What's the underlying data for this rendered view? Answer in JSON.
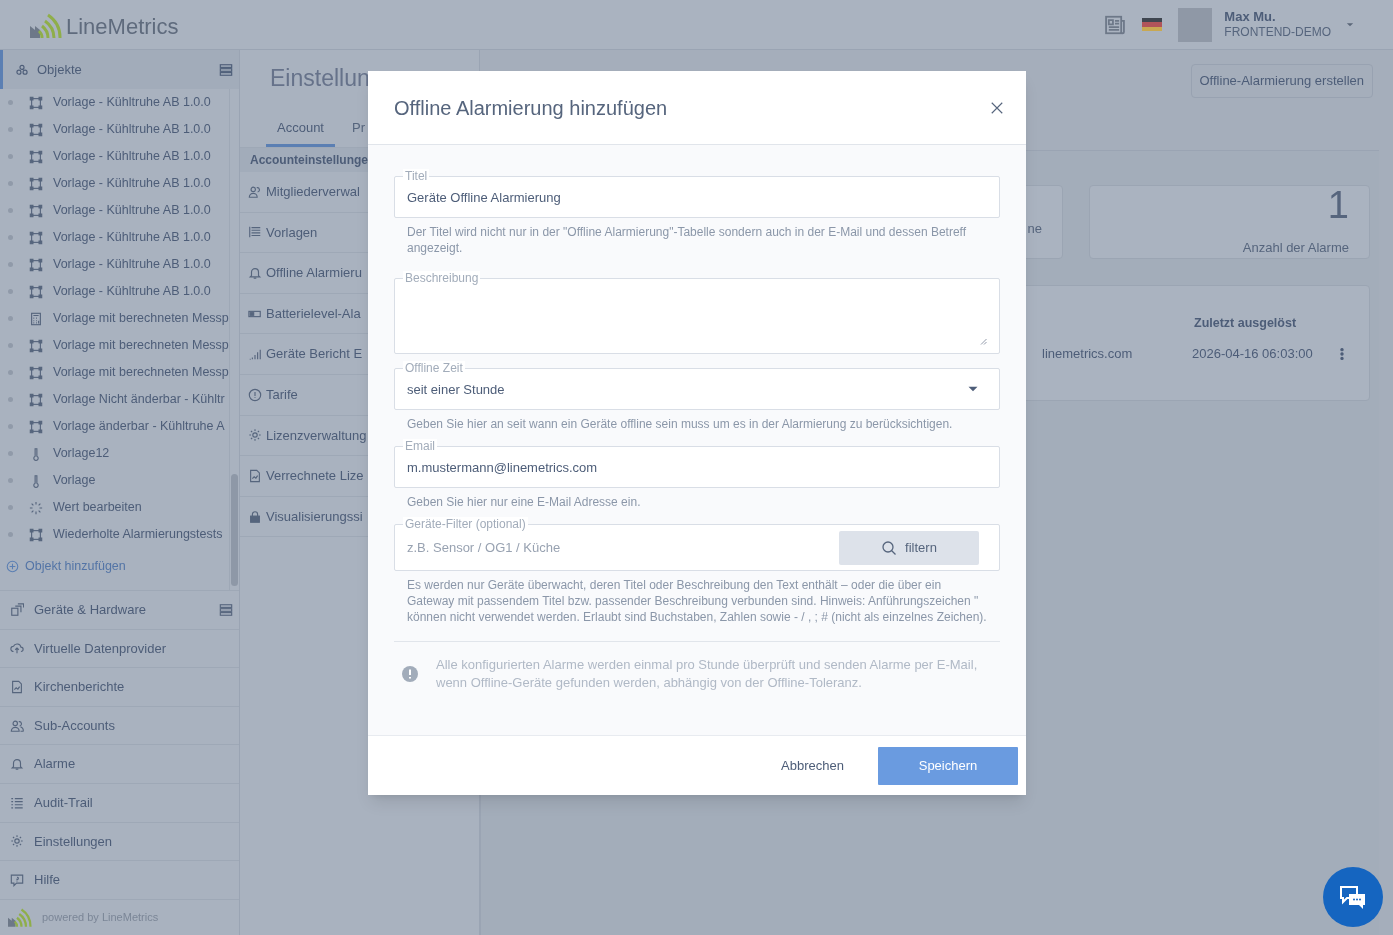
{
  "header": {
    "logo_text": "LineMetrics",
    "user_name": "Max Mu.",
    "user_org": "FRONTEND-DEMO"
  },
  "sidebar": {
    "objects_section": {
      "label": "Objekte",
      "selected": true
    },
    "objects": [
      {
        "label": "Vorlage - Kühltruhe AB 1.0.0",
        "kind": "template"
      },
      {
        "label": "Vorlage - Kühltruhe AB 1.0.0",
        "kind": "template"
      },
      {
        "label": "Vorlage - Kühltruhe AB 1.0.0",
        "kind": "template"
      },
      {
        "label": "Vorlage - Kühltruhe AB 1.0.0",
        "kind": "template"
      },
      {
        "label": "Vorlage - Kühltruhe AB 1.0.0",
        "kind": "template"
      },
      {
        "label": "Vorlage - Kühltruhe AB 1.0.0",
        "kind": "template"
      },
      {
        "label": "Vorlage - Kühltruhe AB 1.0.0",
        "kind": "template"
      },
      {
        "label": "Vorlage - Kühltruhe AB 1.0.0",
        "kind": "template"
      },
      {
        "label": "Vorlage mit berechneten Messp",
        "kind": "calculator"
      },
      {
        "label": "Vorlage mit berechneten Messp",
        "kind": "template"
      },
      {
        "label": "Vorlage mit berechneten Messp",
        "kind": "template"
      },
      {
        "label": "Vorlage Nicht änderbar - Kühltr",
        "kind": "template"
      },
      {
        "label": "Vorlage änderbar - Kühltruhe A",
        "kind": "template"
      },
      {
        "label": "Vorlage12",
        "kind": "sensor"
      },
      {
        "label": "Vorlage",
        "kind": "sensor"
      },
      {
        "label": "Wert bearbeiten",
        "kind": "spinner"
      },
      {
        "label": "Wiederholte Alarmierungstests",
        "kind": "template"
      }
    ],
    "add_object": "Objekt hinzufügen",
    "nav": [
      "Geräte & Hardware",
      "Virtuelle Datenprovider",
      "Kirchenberichte",
      "Sub-Accounts",
      "Alarme",
      "Audit-Trail",
      "Einstellungen",
      "Hilfe"
    ],
    "footer": "powered by LineMetrics"
  },
  "settings": {
    "title": "Einstellun",
    "tabs": [
      {
        "label": "Account",
        "selected": true
      },
      {
        "label": "Pr",
        "selected": false
      }
    ],
    "group_header": "Accounteinstellunge",
    "items": [
      "Mitgliederverwal",
      "Vorlagen",
      "Offline Alarmieru",
      "Batterielevel-Ala",
      "Geräte Bericht E",
      "Tarife",
      "Lizenzverwaltung",
      "Verrechnete Lize",
      "Visualisierungssi"
    ]
  },
  "main": {
    "create_button": "Offline-Alarmierung erstellen",
    "cards": [
      {
        "label": "ne"
      },
      {
        "value": "1",
        "label": "Anzahl der Alarme"
      }
    ],
    "table": {
      "column_2": "Zuletzt ausgelöst",
      "rows": [
        {
          "column_1": "linemetrics.com",
          "column_2": "2026-04-16 06:03:00"
        }
      ]
    }
  },
  "modal": {
    "title": "Offline Alarmierung hinzufügen",
    "fields": [
      {
        "kind": "text",
        "label": "Titel",
        "value": "Geräte Offline Alarmierung",
        "help": "Der Titel wird nicht nur in der \"Offline Alarmierung\"-Tabelle sondern auch in der E-Mail und dessen Betreff angezeigt."
      },
      {
        "kind": "textarea",
        "label": "Beschreibung"
      },
      {
        "kind": "select",
        "label": "Offline Zeit",
        "value": "seit einer Stunde",
        "help": "Geben Sie hier an seit wann ein Geräte offline sein muss um es in der Alarmierung zu berücksichtigen."
      },
      {
        "kind": "text",
        "label": "Email",
        "value": "m.mustermann@linemetrics.com",
        "help": "Geben Sie hier nur eine E-Mail Adresse ein."
      },
      {
        "kind": "filter",
        "label": "Geräte-Filter (optional)",
        "placeholder": "z.B. Sensor / OG1 / Küche",
        "button": "filtern",
        "help": "Es werden nur Geräte überwacht, deren Titel oder Beschreibung den Text enthält – oder die über ein Gateway mit passendem Titel bzw. passender Beschreibung verbunden sind. Hinweis: Anführungszeichen \" können nicht verwendet werden. Erlaubt sind Buchstaben, Zahlen sowie - / , ; # (nicht als einzelnes Zeichen)."
      }
    ],
    "note": "Alle konfigurierten Alarme werden einmal pro Stunde überprüft und senden Alarme per E-Mail, wenn Offline-Geräte gefunden werden, abhängig von der Offline-Toleranz.",
    "cancel": "Abbrechen",
    "save": "Speichern"
  }
}
